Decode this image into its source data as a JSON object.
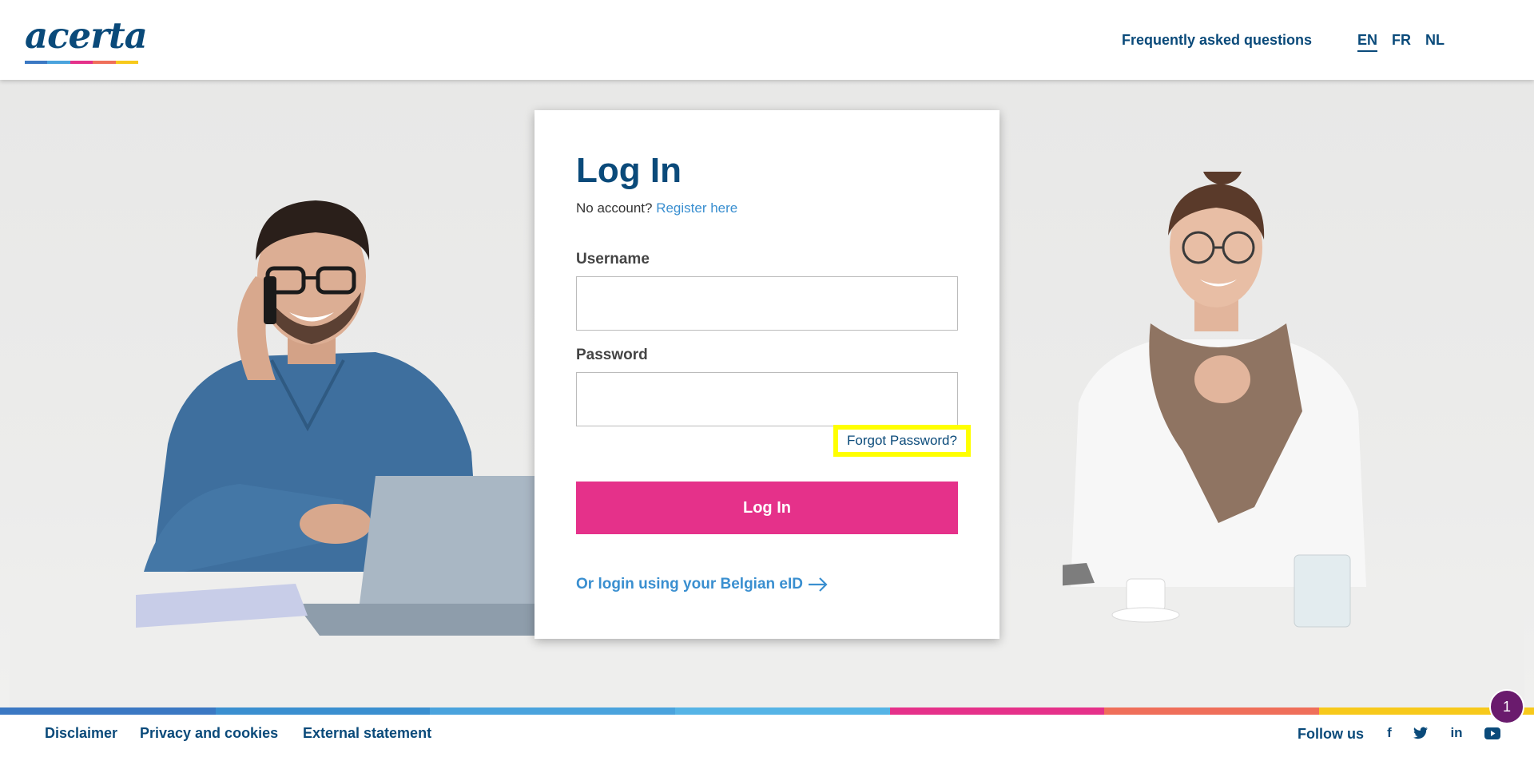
{
  "header": {
    "logo_text": "acerta",
    "faq": "Frequently asked questions",
    "languages": [
      {
        "code": "EN",
        "active": true
      },
      {
        "code": "FR",
        "active": false
      },
      {
        "code": "NL",
        "active": false
      }
    ]
  },
  "login": {
    "title": "Log In",
    "no_account": "No account?",
    "register": "Register here",
    "username_label": "Username",
    "username_value": "",
    "password_label": "Password",
    "password_value": "",
    "forgot": "Forgot Password?",
    "submit": "Log In",
    "eid": "Or login using your Belgian eID"
  },
  "footer": {
    "links": [
      "Disclaimer",
      "Privacy and cookies",
      "External statement"
    ],
    "follow": "Follow us",
    "social": [
      "f",
      "twitter",
      "in",
      "youtube"
    ]
  },
  "notification": {
    "count": "1"
  },
  "colors": {
    "brand_blue": "#0a4a7a",
    "link_blue": "#3a8fd0",
    "pink": "#e5318a",
    "highlight": "#ffff00",
    "stripe": [
      "#3b78c3",
      "#3a8fd0",
      "#4aa3dd",
      "#56b4e6",
      "#e5318a",
      "#ef6f5a",
      "#f7c91b"
    ]
  }
}
